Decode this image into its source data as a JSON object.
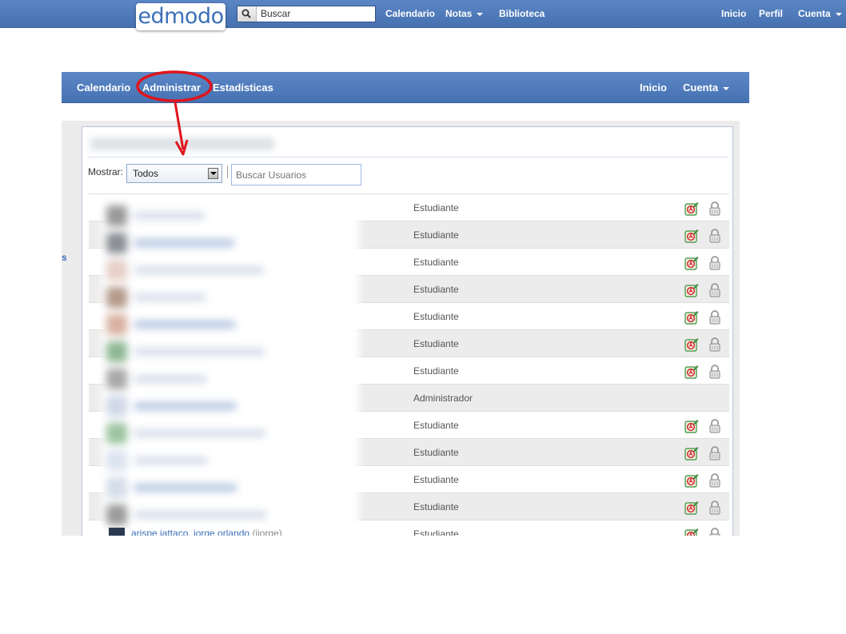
{
  "topbar": {
    "logo": "edmodo",
    "search_placeholder": "Buscar",
    "nav": [
      "Calendario",
      "Notas",
      "Biblioteca"
    ],
    "right": [
      "Inicio",
      "Perfil",
      "Cuenta"
    ]
  },
  "subnav": {
    "left": [
      "Calendario",
      "Administrar",
      "Estadísticas"
    ],
    "right": [
      "Inicio",
      "Cuenta"
    ]
  },
  "left_stub": "s",
  "filter": {
    "label": "Mostrar:",
    "selected": "Todos",
    "search_placeholder": "Buscar Usuarios"
  },
  "rows": [
    {
      "role": "Estudiante"
    },
    {
      "role": "Estudiante"
    },
    {
      "role": "Estudiante"
    },
    {
      "role": "Estudiante"
    },
    {
      "role": "Estudiante"
    },
    {
      "role": "Estudiante"
    },
    {
      "role": "Estudiante"
    },
    {
      "role": "Administrador"
    },
    {
      "role": "Estudiante"
    },
    {
      "role": "Estudiante"
    },
    {
      "role": "Estudiante"
    },
    {
      "role": "Estudiante"
    },
    {
      "role": "Estudiante"
    }
  ],
  "last_user": {
    "name": "arispe iattaco, jorge orlando",
    "handle": "(jiorge)"
  },
  "colors": {
    "bar": "#4a76b6",
    "annotation": "#e0141b",
    "link": "#3b6fb7"
  }
}
